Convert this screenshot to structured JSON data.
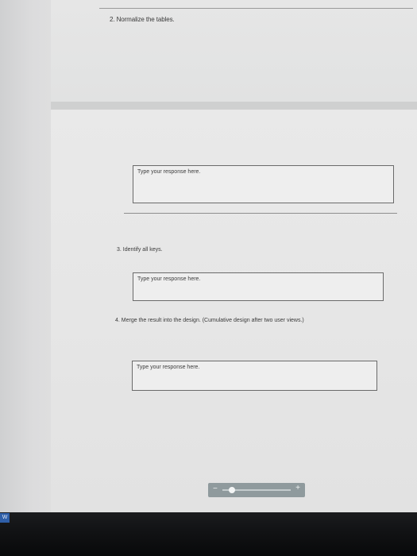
{
  "questions": {
    "q2_label": "2.  Normalize the tables.",
    "q3_label": "3.  Identify all keys.",
    "q4_label": "4.  Merge the result into the design. (Cumulative design after two user views.)"
  },
  "responses": [
    {
      "placeholder": "Type your response here."
    },
    {
      "placeholder": "Type your response here."
    },
    {
      "placeholder": "Type your response here."
    }
  ],
  "zoom": {
    "minus_label": "−",
    "plus_label": "+",
    "level": 0.1
  },
  "taskbar": {
    "app_icon_label": "W",
    "app_icon_name": "word-icon"
  },
  "colors": {
    "app_icon": "#2f5fa8",
    "taskbar": "#121315"
  }
}
